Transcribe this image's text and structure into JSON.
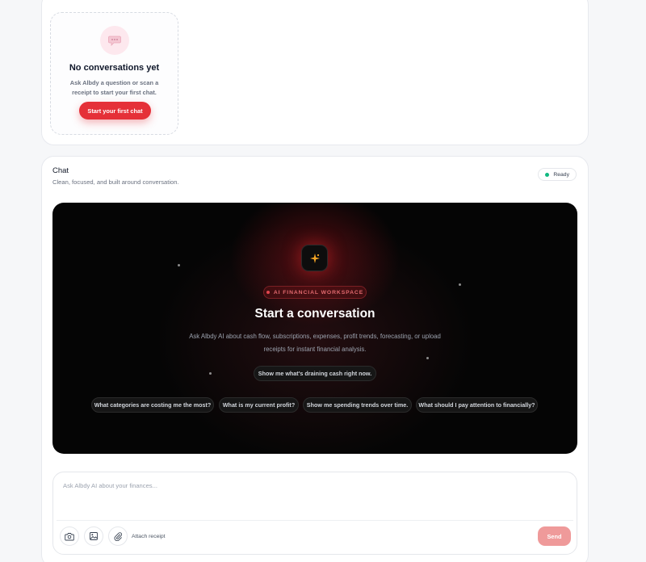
{
  "conversations": {
    "empty_title": "No conversations yet",
    "empty_description": "Ask Albdy a question or scan a receipt to start your first chat.",
    "start_button_label": "Start your first chat"
  },
  "chat": {
    "title": "Chat",
    "subtitle": "Clean, focused, and built around conversation.",
    "status": "Ready",
    "status_color": "#10b981"
  },
  "hero": {
    "badge": "AI FINANCIAL WORKSPACE",
    "title": "Start a conversation",
    "description": "Ask Albdy AI about cash flow, subscriptions, expenses, profit trends, forecasting, or upload receipts for instant financial analysis.",
    "primary_suggestion": "Show me what's draining cash right now.",
    "suggestions": [
      "What categories are costing me the most?",
      "What is my current profit?",
      "Show me spending trends over time.",
      "What should I pay attention to financially?"
    ]
  },
  "composer": {
    "placeholder": "Ask Albdy AI about your finances...",
    "value": "",
    "attach_label": "Attach receipt",
    "send_label": "Send",
    "tools": [
      "camera-icon",
      "image-icon",
      "paperclip-icon"
    ]
  },
  "colors": {
    "accent": "#e53038",
    "send_disabled": "#ef9a9a",
    "hero_bg": "#050505"
  }
}
